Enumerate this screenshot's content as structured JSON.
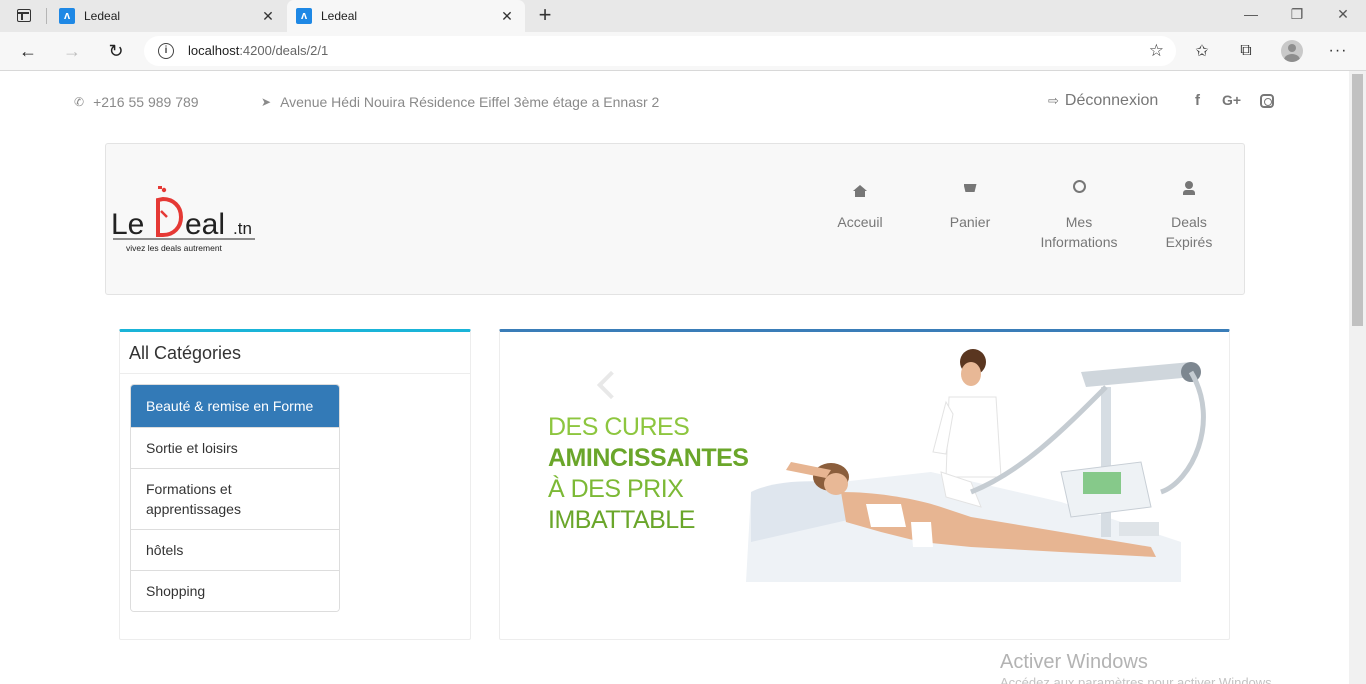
{
  "browser": {
    "tabs": [
      {
        "title": "Ledeal"
      },
      {
        "title": "Ledeal"
      }
    ],
    "address": {
      "host": "localhost",
      "path": ":4200/deals/2/1"
    }
  },
  "topbar": {
    "phone": "+216 55 989 789",
    "address": "Avenue Hédi Nouira Résidence Eiffel 3ème étage a Ennasr 2",
    "logout": "Déconnexion",
    "social": {
      "facebook": "f",
      "googleplus": "G+"
    }
  },
  "logo": {
    "wordmark": "LeDeal.tn",
    "tagline": "vivez les deals autrement"
  },
  "menu": {
    "home": "Acceuil",
    "cart": "Panier",
    "info_line1": "Mes",
    "info_line2": "Informations",
    "expired_line1": "Deals",
    "expired_line2": "Expirés"
  },
  "categories": {
    "title": "All Catégories",
    "items": [
      {
        "label": "Beauté & remise en Forme"
      },
      {
        "label": "Sortie et loisirs"
      },
      {
        "label": "Formations et apprentissages"
      },
      {
        "label": "hôtels"
      },
      {
        "label": "Shopping"
      }
    ]
  },
  "slider": {
    "line1": "DES CURES",
    "line2": "AMINCISSANTES",
    "line3": "À DES PRIX",
    "line4": "IMBATTABLE"
  },
  "watermark": {
    "title": "Activer Windows",
    "subtitle": "Accédez aux paramètres pour activer Windows."
  },
  "colors": {
    "accent_cyan": "#1ab4d8",
    "accent_blue": "#337ab7",
    "slide_green": "#8dc63f",
    "logo_red": "#e53935"
  }
}
